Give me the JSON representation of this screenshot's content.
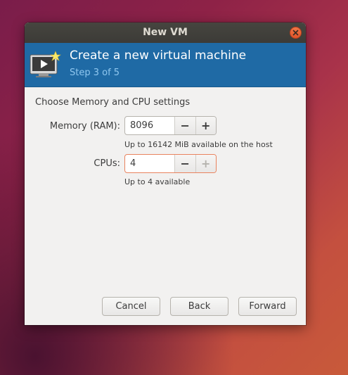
{
  "window": {
    "title": "New VM"
  },
  "header": {
    "title": "Create a new virtual machine",
    "step": "Step 3 of 5",
    "icon": "vm-monitor-icon",
    "accent": "#1f6aa5"
  },
  "content": {
    "section_title": "Choose Memory and CPU settings",
    "memory": {
      "label": "Memory (RAM):",
      "value": "8096",
      "hint": "Up to 16142 MiB available on the host"
    },
    "cpus": {
      "label": "CPUs:",
      "value": "4",
      "hint": "Up to 4 available"
    },
    "decrement_symbol": "−",
    "increment_symbol": "+"
  },
  "footer": {
    "cancel_label": "Cancel",
    "back_label": "Back",
    "forward_label": "Forward"
  }
}
